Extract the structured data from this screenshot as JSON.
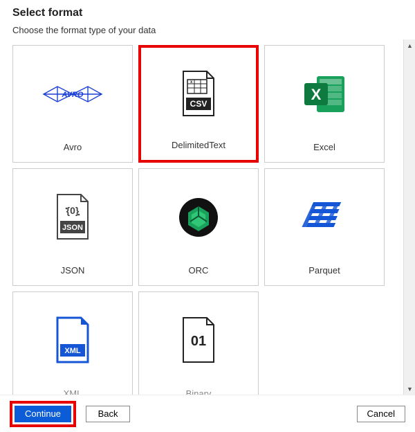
{
  "header": {
    "title": "Select format",
    "subtitle": "Choose the format type of your data"
  },
  "formats": [
    {
      "id": "avro",
      "label": "Avro",
      "icon": "avro-icon",
      "selected": false
    },
    {
      "id": "csv",
      "label": "DelimitedText",
      "icon": "csv-icon",
      "selected": true
    },
    {
      "id": "excel",
      "label": "Excel",
      "icon": "excel-icon",
      "selected": false
    },
    {
      "id": "json",
      "label": "JSON",
      "icon": "json-icon",
      "selected": false
    },
    {
      "id": "orc",
      "label": "ORC",
      "icon": "orc-icon",
      "selected": false
    },
    {
      "id": "parquet",
      "label": "Parquet",
      "icon": "parquet-icon",
      "selected": false
    },
    {
      "id": "xml",
      "label": "XML",
      "icon": "xml-icon",
      "selected": false
    },
    {
      "id": "binary",
      "label": "Binary",
      "icon": "binary-icon",
      "selected": false
    }
  ],
  "footer": {
    "continue_label": "Continue",
    "back_label": "Back",
    "cancel_label": "Cancel"
  }
}
